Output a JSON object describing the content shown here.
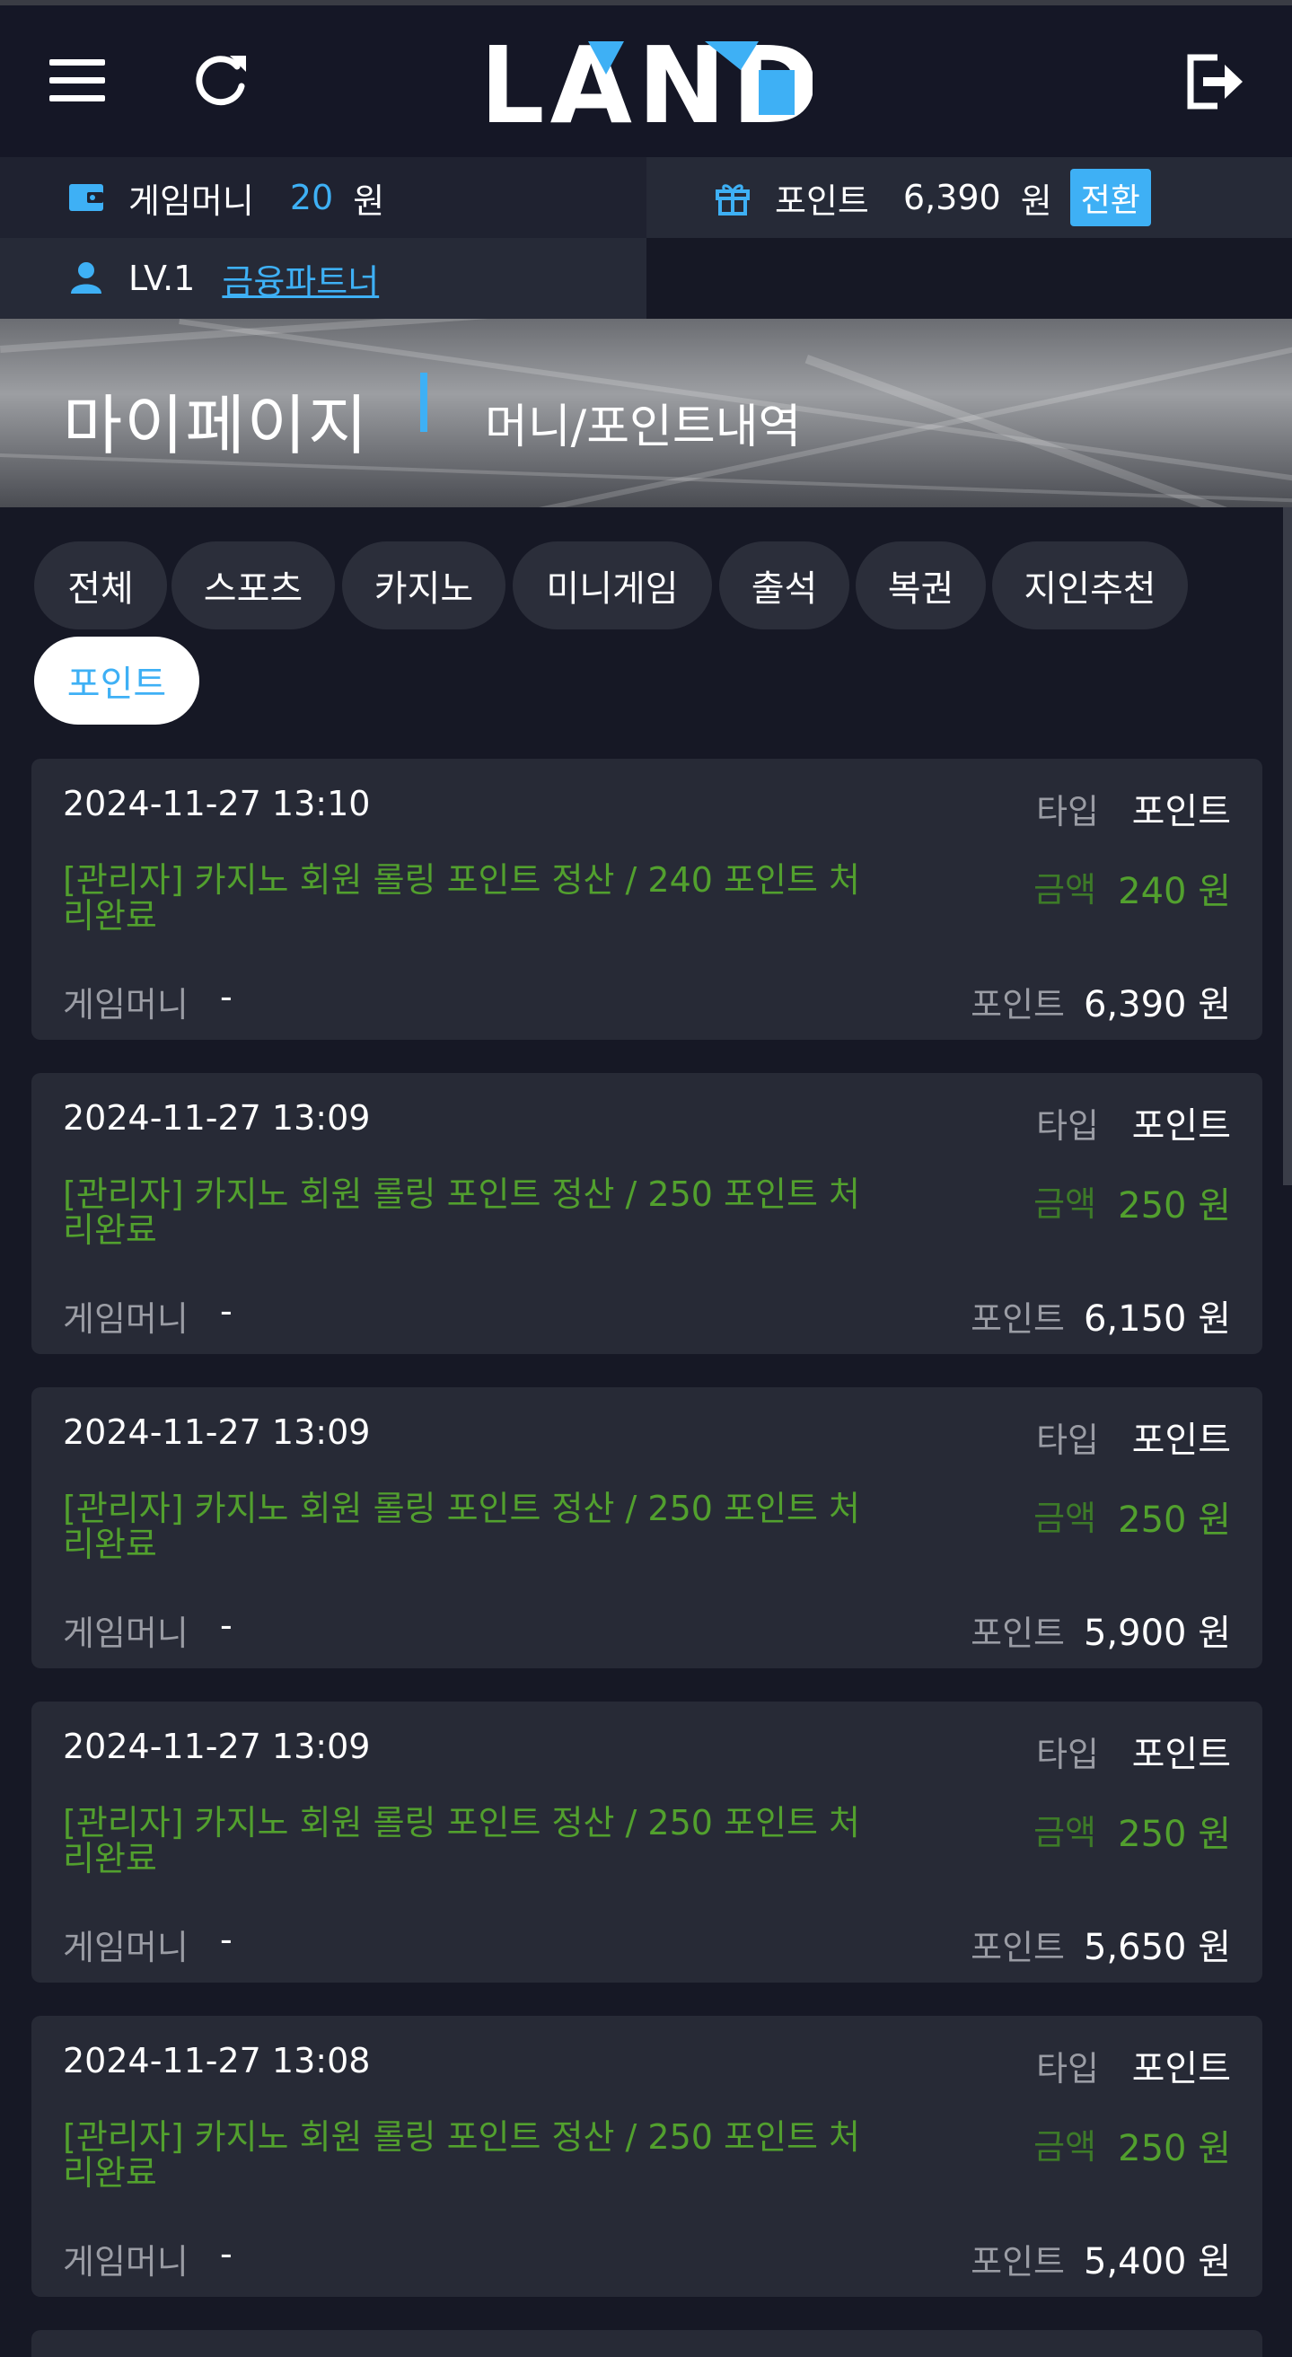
{
  "header": {
    "menu_icon": "hamburger-icon",
    "refresh_icon": "refresh-icon",
    "logo_text": "LAND",
    "logout_icon": "logout-icon"
  },
  "info": {
    "money_label": "게임머니",
    "money_value": "20",
    "money_unit": "원",
    "point_label": "포인트",
    "point_value": "6,390",
    "point_unit": "원",
    "convert_label": "전환",
    "level": "LV.1",
    "partner_link": "금융파트너"
  },
  "banner": {
    "title": "마이페이지",
    "subtitle": "머니/포인트내역"
  },
  "tabs": [
    "전체",
    "스포츠",
    "카지노",
    "미니게임",
    "출석",
    "복권",
    "지인추천",
    "포인트"
  ],
  "active_tab": "포인트",
  "labels": {
    "type": "타입",
    "amount": "금액",
    "game_money": "게임머니",
    "point": "포인트"
  },
  "records": [
    {
      "date": "2024-11-27 13:10",
      "type": "포인트",
      "desc": "[관리자] 카지노 회원 롤링 포인트 정산 / 240 포인트 처리완료",
      "amount": "240 원",
      "game_money": "-",
      "point": "6,390 원"
    },
    {
      "date": "2024-11-27 13:09",
      "type": "포인트",
      "desc": "[관리자] 카지노 회원 롤링 포인트 정산 / 250 포인트 처리완료",
      "amount": "250 원",
      "game_money": "-",
      "point": "6,150 원"
    },
    {
      "date": "2024-11-27 13:09",
      "type": "포인트",
      "desc": "[관리자] 카지노 회원 롤링 포인트 정산 / 250 포인트 처리완료",
      "amount": "250 원",
      "game_money": "-",
      "point": "5,900 원"
    },
    {
      "date": "2024-11-27 13:09",
      "type": "포인트",
      "desc": "[관리자] 카지노 회원 롤링 포인트 정산 / 250 포인트 처리완료",
      "amount": "250 원",
      "game_money": "-",
      "point": "5,650 원"
    },
    {
      "date": "2024-11-27 13:08",
      "type": "포인트",
      "desc": "[관리자] 카지노 회원 롤링 포인트 정산 / 250 포인트 처리완료",
      "amount": "250 원",
      "game_money": "-",
      "point": "5,400 원"
    }
  ],
  "colors": {
    "background": "#161825",
    "accent": "#3eb0f5",
    "amount_green": "#52a02e",
    "card": "#272a36"
  }
}
